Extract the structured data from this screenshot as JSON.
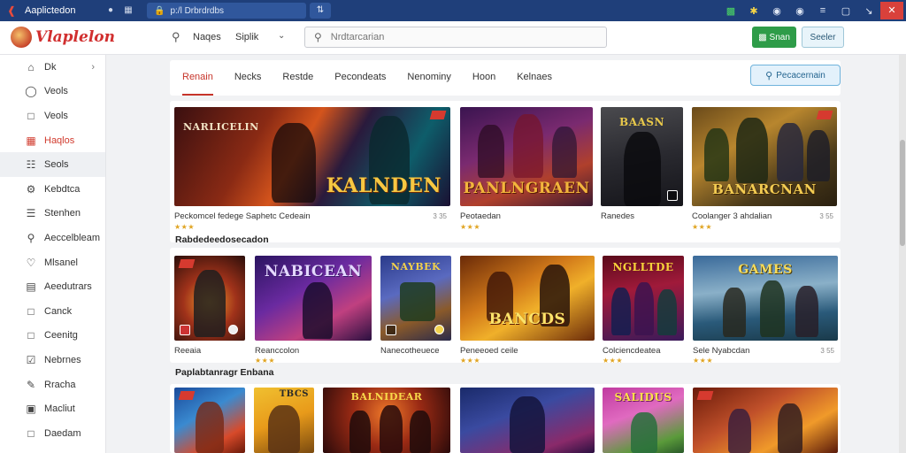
{
  "window": {
    "title": "Aaplictedon",
    "tab_title": "p:/l Drbrdrdbs"
  },
  "header": {
    "logo_text": "Vlaplelon",
    "nav_link_1": "Naqes",
    "nav_link_2": "Siplik",
    "search_placeholder": "Nrdtarcarian",
    "btn_primary": "Snan",
    "btn_secondary": "Seeler"
  },
  "sidebar": {
    "items": [
      {
        "label": "Dk",
        "icon": "home-icon"
      },
      {
        "label": "Veols",
        "icon": "user-icon"
      },
      {
        "label": "Veols",
        "icon": "bookmark-icon"
      },
      {
        "label": "Haqlos",
        "icon": "calendar-icon",
        "active": true
      },
      {
        "label": "Seols",
        "icon": "grid-icon",
        "hover": true
      },
      {
        "label": "Kebdtca",
        "icon": "gear-icon"
      },
      {
        "label": "Stenhen",
        "icon": "list-icon"
      },
      {
        "label": "Aeccelbleam",
        "icon": "cart-icon"
      },
      {
        "label": "Mlsanel",
        "icon": "heart-icon"
      },
      {
        "label": "Aeedutrars",
        "icon": "chart-icon"
      },
      {
        "label": "Canck",
        "icon": "chat-icon"
      },
      {
        "label": "Ceenitg",
        "icon": "square-icon"
      },
      {
        "label": "Nebrnes",
        "icon": "checkbox-icon"
      },
      {
        "label": "Rracha",
        "icon": "edit-icon"
      },
      {
        "label": "Macliut",
        "icon": "box-icon"
      },
      {
        "label": "Daedam",
        "icon": "square-icon"
      }
    ]
  },
  "tabs": [
    {
      "label": "Renain",
      "active": true
    },
    {
      "label": "Necks"
    },
    {
      "label": "Restde"
    },
    {
      "label": "Pecondeats"
    },
    {
      "label": "Nenominy"
    },
    {
      "label": "Hoon"
    },
    {
      "label": "Kelnaes"
    }
  ],
  "recommend_btn": "Pecacernain",
  "shelf1": {
    "cards": [
      {
        "art_title_top": "NARLICELIN",
        "art_title": "KALNDEN",
        "caption": "Peckomcel fedege Saphetc Cedeain",
        "meta": "3 35",
        "stars": "★★★"
      },
      {
        "art_title": "PANLNGRAEN",
        "caption": "Peotaedan",
        "stars": "★★★"
      },
      {
        "art_title_top": "BAASN",
        "caption": "Ranedes"
      },
      {
        "art_title": "BANARCNAN",
        "caption": "Coolanger 3 ahdalian",
        "meta": "3 55",
        "stars": "★★★"
      }
    ]
  },
  "section2_title": "Rabdedeedosecadon",
  "shelf2": {
    "cards": [
      {
        "caption": "Reeaia"
      },
      {
        "art_title": "NABICEAN",
        "caption": "Reanccolon",
        "stars": "★★★"
      },
      {
        "art_title_top": "NAYBEK",
        "caption": "Nanecotheuece"
      },
      {
        "art_title": "BANCDS",
        "caption": "Peneeoed ceile",
        "stars": "★★★"
      },
      {
        "art_title_top": "NGLLTDE",
        "caption": "Colciencdeatea",
        "stars": "★★★"
      },
      {
        "art_title_top": "GAMES",
        "caption": "Sele Nyabcdan",
        "meta": "3 55",
        "stars": "★★★"
      }
    ]
  },
  "section3_title": "Paplabtanragr Enbana",
  "shelf3": {
    "cards": [
      {
        "art_title_top": ""
      },
      {
        "art_title_top": "TBCS"
      },
      {
        "art_title_top": "BALNIDEAR"
      },
      {
        "art_title_top": ""
      },
      {
        "art_title_top": "SALIDUS"
      },
      {
        "art_title_top": ""
      }
    ]
  }
}
